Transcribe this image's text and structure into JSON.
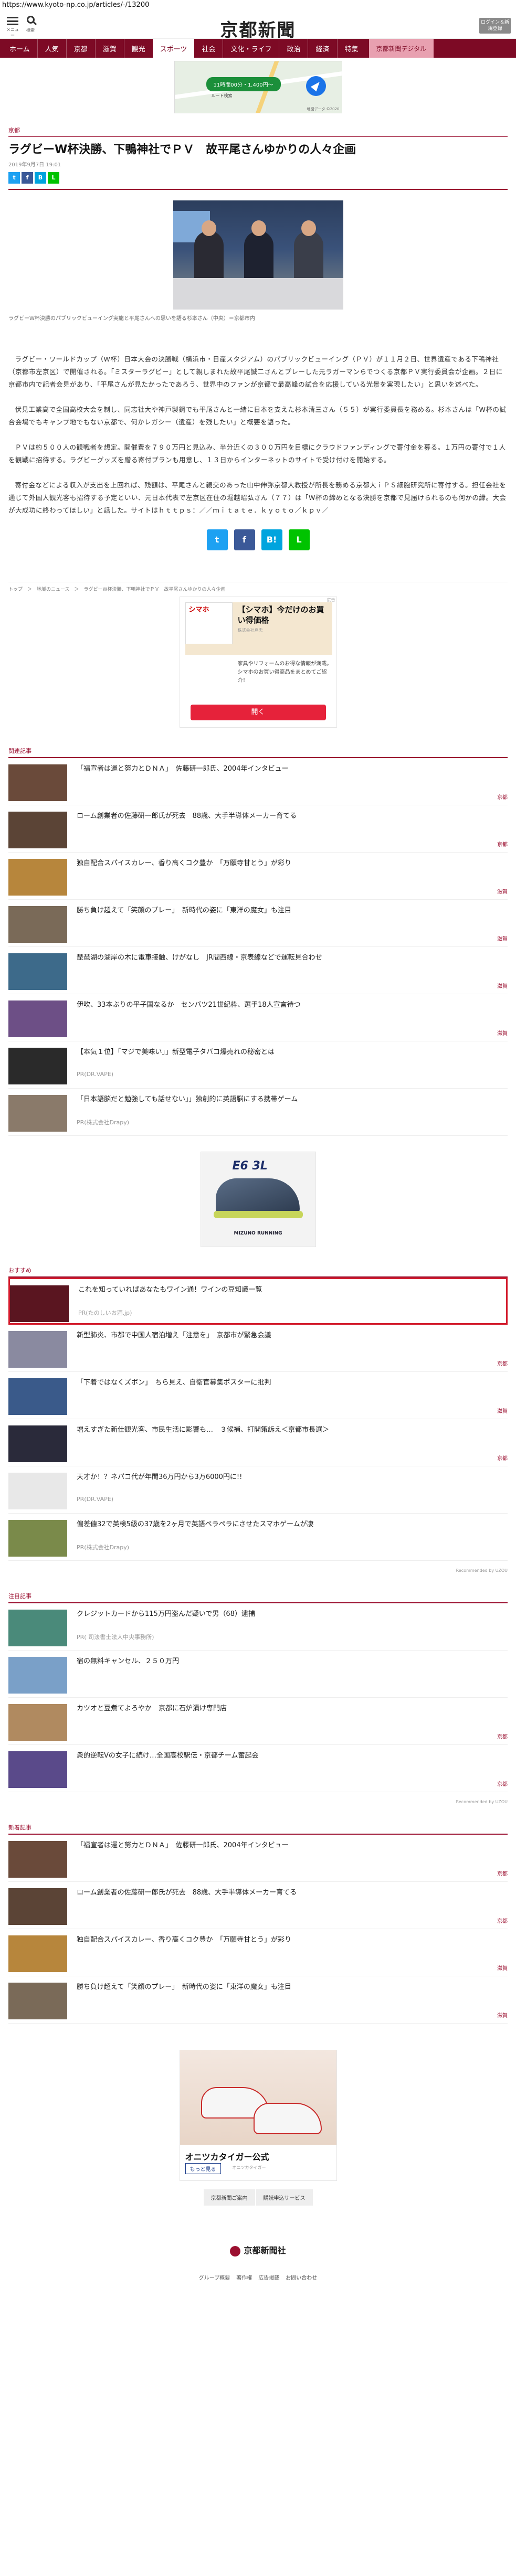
{
  "url": "https://www.kyoto-np.co.jp/articles/-/13200",
  "header": {
    "menu_label": "メニュー",
    "search_label": "検索",
    "logo": "京都新聞",
    "login_label": "ログイン＆新規登録"
  },
  "nav": [
    "ホーム",
    "人気",
    "京都",
    "滋賀",
    "観光",
    "スポーツ",
    "社会",
    "文化・ライフ",
    "政治",
    "経済",
    "特集",
    "京都新聞デジタル"
  ],
  "ad_top": {
    "pill": "11時間00分・1,400円～",
    "sub": "ルート検索",
    "credit": "地図データ ©2020"
  },
  "article": {
    "section": "京都",
    "title": "ラグビーW杯決勝、下鴨神社でＰＶ　故平尾さんゆかりの人々企画",
    "date": "2019年9月7日 19:01",
    "caption": "ラグビーW杯決勝のパブリックビューイング実施と平尾さんへの思いを語る杉本さん（中央）＝京都市内",
    "paragraphs": [
      "ラグビー・ワールドカップ（W杯）日本大会の決勝戦（横浜市・日産スタジアム）のパブリックビューイング（ＰＶ）が１１月２日、世界遺産である下鴨神社（京都市左京区）で開催される。「ミスターラグビー」として親しまれた故平尾誠二さんとプレーした元ラガーマンらでつくる京都ＰＶ実行委員会が企画。２日に京都市内で記者会見があり、「平尾さんが見たかったであろう、世界中のファンが京都で最高峰の試合を応援している光景を実現したい」と思いを述べた。",
      "伏見工業高で全国高校大会を制し、同志社大や神戸製鋼でも平尾さんと一緒に日本を支えた杉本清三さん（５５）が実行委員長を務める。杉本さんは「W杯の試合会場でもキャンプ地でもない京都で、何かレガシー（遺産）を残したい」と概要を語った。",
      "ＰＶは約５００人の観戦者を想定。開催費を７９０万円と見込み、半分近くの３００万円を目標にクラウドファンディングで寄付金を募る。１万円の寄付で１人を観戦に招待する。ラグビーグッズを贈る寄付プランも用意し、１３日からインターネットのサイトで受け付けを開始する。",
      "寄付金などによる収入が支出を上回れば、残額は、平尾さんと親交のあった山中伸弥京都大教授が所長を務める京都大ｉＰＳ細胞研究所に寄付する。担任会社を通じて外国人観光客も招待する予定といい、元日本代表で左京区在住の堀越昭弘さん（７７）は「W杯の締めとなる決勝を京都で見届けられるのも何かの縁。大会が大成功に終わってほしい」と話した。サイトはｈｔｔｐｓ：／／ｍｉｔａｔｅ．ｋｙｏｔｏ／ｋｐｖ／"
    ],
    "breadcrumb": "トップ　＞　地域のニュース　＞　ラグビーW杯決勝、下鴨神社でＰＶ　故平尾さんゆかりの人々企画"
  },
  "ad_middle": {
    "shop": "シマホ",
    "headline": "【シマホ】今だけのお買い得価格",
    "sponsor": "株式会社島忠",
    "desc": "家具やリフォームのお得な情報が満載。シマホのお買い得商品をまとめてご紹介！",
    "button": "開く",
    "adchoices": "広告"
  },
  "related": {
    "label": "関連記事",
    "items": [
      {
        "title": "「福宣者は運と努力とＤＮＡ」　佐藤研一郎氏、2004年インタビュー",
        "cat": "京都",
        "thumb": "#6a4a3a"
      },
      {
        "title": "ローム創業者の佐藤研一郎氏が死去　88歳、大手半導体メーカー育てる",
        "cat": "京都",
        "thumb": "#5b4436"
      },
      {
        "title": "独自配合スパイスカレー、香り高くコク豊か　「万願寺甘とう」が彩り",
        "cat": "滋賀",
        "thumb": "#b7863c"
      },
      {
        "title": "勝ち負け超えて「笑顔のプレー」　新時代の姿に「東洋の魔女」も注目",
        "cat": "滋賀",
        "thumb": "#7a6a58"
      },
      {
        "title": "琵琶湖の湖岸の木に電車接触、けがなし　JR間西線・京表線などで運転見合わせ",
        "cat": "滋賀",
        "thumb": "#3d6a8a"
      },
      {
        "title": "伊吹、33本ぶりの平子国なるか　センバツ21世紀枠、選手18人宣言待つ",
        "cat": "滋賀",
        "thumb": "#6d4f86"
      },
      {
        "title": "【本気１位】「マジで美味い」」新型電子タバコ爆売れの秘密とは",
        "cat": "PR(DR.VAPE)",
        "thumb": "#2a2a2a",
        "pr": true
      },
      {
        "title": "「日本語脳だと勉強しても話せない」」独創的に英語脳にする携帯ゲーム",
        "cat": "PR(株式会社Drapy)",
        "thumb": "#8a7a6a",
        "pr": true
      }
    ]
  },
  "ad_shoe": {
    "badge": "E6 3L",
    "text": "MIZUNO RUNNING"
  },
  "recommend": {
    "label": "おすすめ",
    "items": [
      {
        "title": "これを知っていればあなたもワイン通！ワインの豆知識一覧",
        "cat": "PR(たのしいお酒.jp)",
        "thumb": "#5a1520",
        "pr": true,
        "highlight": true
      },
      {
        "title": "新型肺炎、市都で中国人宿泊増え「注意を」　京都市が緊急会議",
        "cat": "京都",
        "thumb": "#8a8aa0"
      },
      {
        "title": "「下着ではなくズボン」　ちら見え、自衛官募集ポスターに批判",
        "cat": "滋賀",
        "thumb": "#3a5a8a"
      },
      {
        "title": "増えすぎた新仕観光客、市民生活に影響も…　３候補、打開策訴え＜京都市長選＞",
        "cat": "京都",
        "thumb": "#2a2a3a"
      },
      {
        "title": "天才か！？ネパコ代が年間36万円から3万6000円に!!",
        "cat": "PR(DR.VAPE)",
        "thumb": "#e8e8e8",
        "pr": true
      },
      {
        "title": "偏差値32で英検5級の37歳を2ヶ月で英語ペラペラにさせたスマホゲームが凄",
        "cat": "PR(株式会社Drapy)",
        "thumb": "#7a8a4a",
        "pr": true
      }
    ],
    "credit": "Recommended by UZOU"
  },
  "notable": {
    "label": "注目記事",
    "items": [
      {
        "title": "クレジットカードから115万円盗んだ疑いで男（68）逮捕",
        "cat": "PR( 司法書士法人中央事務所)",
        "thumb": "#4a8a7a",
        "pr": true
      },
      {
        "title": "宿の無料キャンセル、２５０万円",
        "cat": "",
        "thumb": "#7aa0c8"
      },
      {
        "title": "カツオと豆煮てよろやか　京都に石炉漬け専門店",
        "cat": "京都",
        "thumb": "#b08a60"
      },
      {
        "title": "衆的逆転Vの女子に続け…全国高校駅伝・京都チーム奮起会",
        "cat": "京都",
        "thumb": "#5a4a8a"
      }
    ],
    "credit": "Recommended by UZOU"
  },
  "newest": {
    "label": "新着記事",
    "items": [
      {
        "title": "「福宣者は運と努力とＤＮＡ」　佐藤研一郎氏、2004年インタビュー",
        "cat": "京都",
        "thumb": "#6a4a3a"
      },
      {
        "title": "ローム創業者の佐藤研一郎氏が死去　88歳、大手半導体メーカー育てる",
        "cat": "京都",
        "thumb": "#5b4436"
      },
      {
        "title": "独自配合スパイスカレー、香り高くコク豊か　「万願寺甘とう」が彩り",
        "cat": "滋賀",
        "thumb": "#b7863c"
      },
      {
        "title": "勝ち負け超えて「笑顔のプレー」　新時代の姿に「東洋の魔女」も注目",
        "cat": "滋賀",
        "thumb": "#7a6a58"
      }
    ]
  },
  "ad_bottom": {
    "name": "オニツカタイガー公式",
    "more": "もっと見る",
    "sub": "オニツカタイガー"
  },
  "footer": {
    "links": [
      "京都新聞ご案内",
      "購読申込サービス"
    ],
    "logo": "京都新聞社",
    "menu": [
      "グループ概要",
      "著作権",
      "広告掲載",
      "お問い合わせ"
    ]
  },
  "colors": {
    "brand": "#7d0a25",
    "accent": "#9b1030",
    "highlight": "#d21a2b"
  }
}
